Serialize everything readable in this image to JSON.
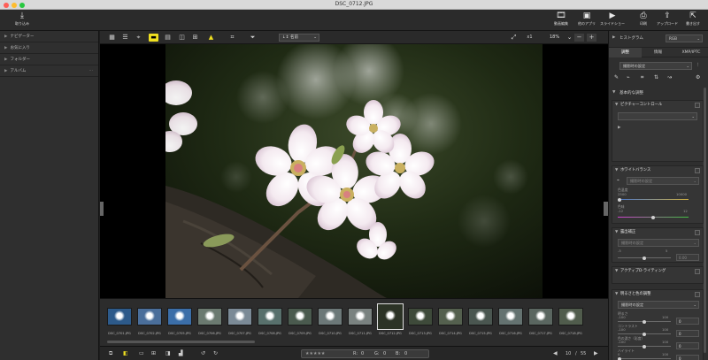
{
  "window": {
    "title": "DSC_0712.JPG"
  },
  "toolbar": {
    "import_label": "取り込み",
    "right_buttons": [
      {
        "icon": "film-icon",
        "label": "動画編集"
      },
      {
        "icon": "nx-icon",
        "label": "他のアプリ"
      },
      {
        "icon": "slideshow-icon",
        "label": "スライドショー"
      },
      {
        "icon": "print-icon",
        "label": "印刷"
      },
      {
        "icon": "upload-icon",
        "label": "アップロード"
      },
      {
        "icon": "export-icon",
        "label": "書き出す"
      }
    ]
  },
  "left_panel": {
    "items": [
      {
        "label": "ナビゲーター"
      },
      {
        "label": "お気に入り"
      },
      {
        "label": "フォルダー"
      },
      {
        "label": "アルバム"
      }
    ]
  },
  "view_bar": {
    "sort_label": "名前",
    "zoom_percent": "18%",
    "x1_label": "x1"
  },
  "filmstrip": {
    "selected_index": 9,
    "scroll_fraction": 0.3,
    "thumbnails": [
      {
        "name": "DSC_0701.JPG",
        "color": "#2d5a8a"
      },
      {
        "name": "DSC_0702.JPG",
        "color": "#4a6e9a"
      },
      {
        "name": "DSC_0705.JPG",
        "color": "#3b6ea8"
      },
      {
        "name": "DSC_0706.JPG",
        "color": "#6b7a70"
      },
      {
        "name": "DSC_0707.JPG",
        "color": "#7b8a96"
      },
      {
        "name": "DSC_0708.JPG",
        "color": "#58706c"
      },
      {
        "name": "DSC_0709.JPG",
        "color": "#4a5a4e"
      },
      {
        "name": "DSC_0710.JPG",
        "color": "#6c7878"
      },
      {
        "name": "DSC_0711.JPG",
        "color": "#7a8280"
      },
      {
        "name": "DSC_0712.JPG",
        "color": "#2c3326"
      },
      {
        "name": "DSC_0713.JPG",
        "color": "#3e4a3a"
      },
      {
        "name": "DSC_0714.JPG",
        "color": "#54604e"
      },
      {
        "name": "DSC_0715.JPG",
        "color": "#4a5650"
      },
      {
        "name": "DSC_0716.JPG",
        "color": "#647270"
      },
      {
        "name": "DSC_0717.JPG",
        "color": "#5a6660"
      },
      {
        "name": "DSC_0718.JPG",
        "color": "#505c4c"
      }
    ]
  },
  "bottom_bar": {
    "rating": "★★★★★",
    "r_label": "R:",
    "r_value": "0",
    "g_label": "G:",
    "g_value": "0",
    "b_label": "B:",
    "b_value": "0",
    "page_current": "10",
    "page_total": "55",
    "page_sep": "/"
  },
  "right_panel": {
    "histogram_label": "ヒストグラム",
    "histogram_channel": "RGB",
    "tabs": [
      "調整",
      "情報",
      "XMP/IPTC"
    ],
    "preset_select": "撮影時の設定",
    "basic_section": "基本的な調整",
    "picture_control": {
      "title": "ピクチャーコントロール"
    },
    "white_balance": {
      "title": "ホワイトバランス",
      "select": "撮影時の設定",
      "temp_label": "色温度",
      "temp_min": "2500",
      "temp_max": "10000",
      "tint_label": "色味",
      "tint_min": "-12",
      "tint_max": "12"
    },
    "exposure": {
      "title": "露出補正",
      "select": "撮影時の設定",
      "min": "-5",
      "max": "5",
      "value": "0.00"
    },
    "active_dlighting": {
      "title": "アクティブD-ライティング"
    },
    "tone": {
      "title": "明るさと色の調整",
      "select": "撮影時の設定",
      "sliders": [
        {
          "label": "明るさ",
          "min": "-100",
          "max": "100",
          "value": "0"
        },
        {
          "label": "コントラスト",
          "min": "-100",
          "max": "100",
          "value": "0"
        },
        {
          "label": "色の濃さ（彩度）",
          "min": "-100",
          "max": "100",
          "value": "0"
        },
        {
          "label": "ハイライト",
          "min": "0",
          "max": "100",
          "value": "0"
        }
      ],
      "shadow_label": "シャドー"
    }
  }
}
